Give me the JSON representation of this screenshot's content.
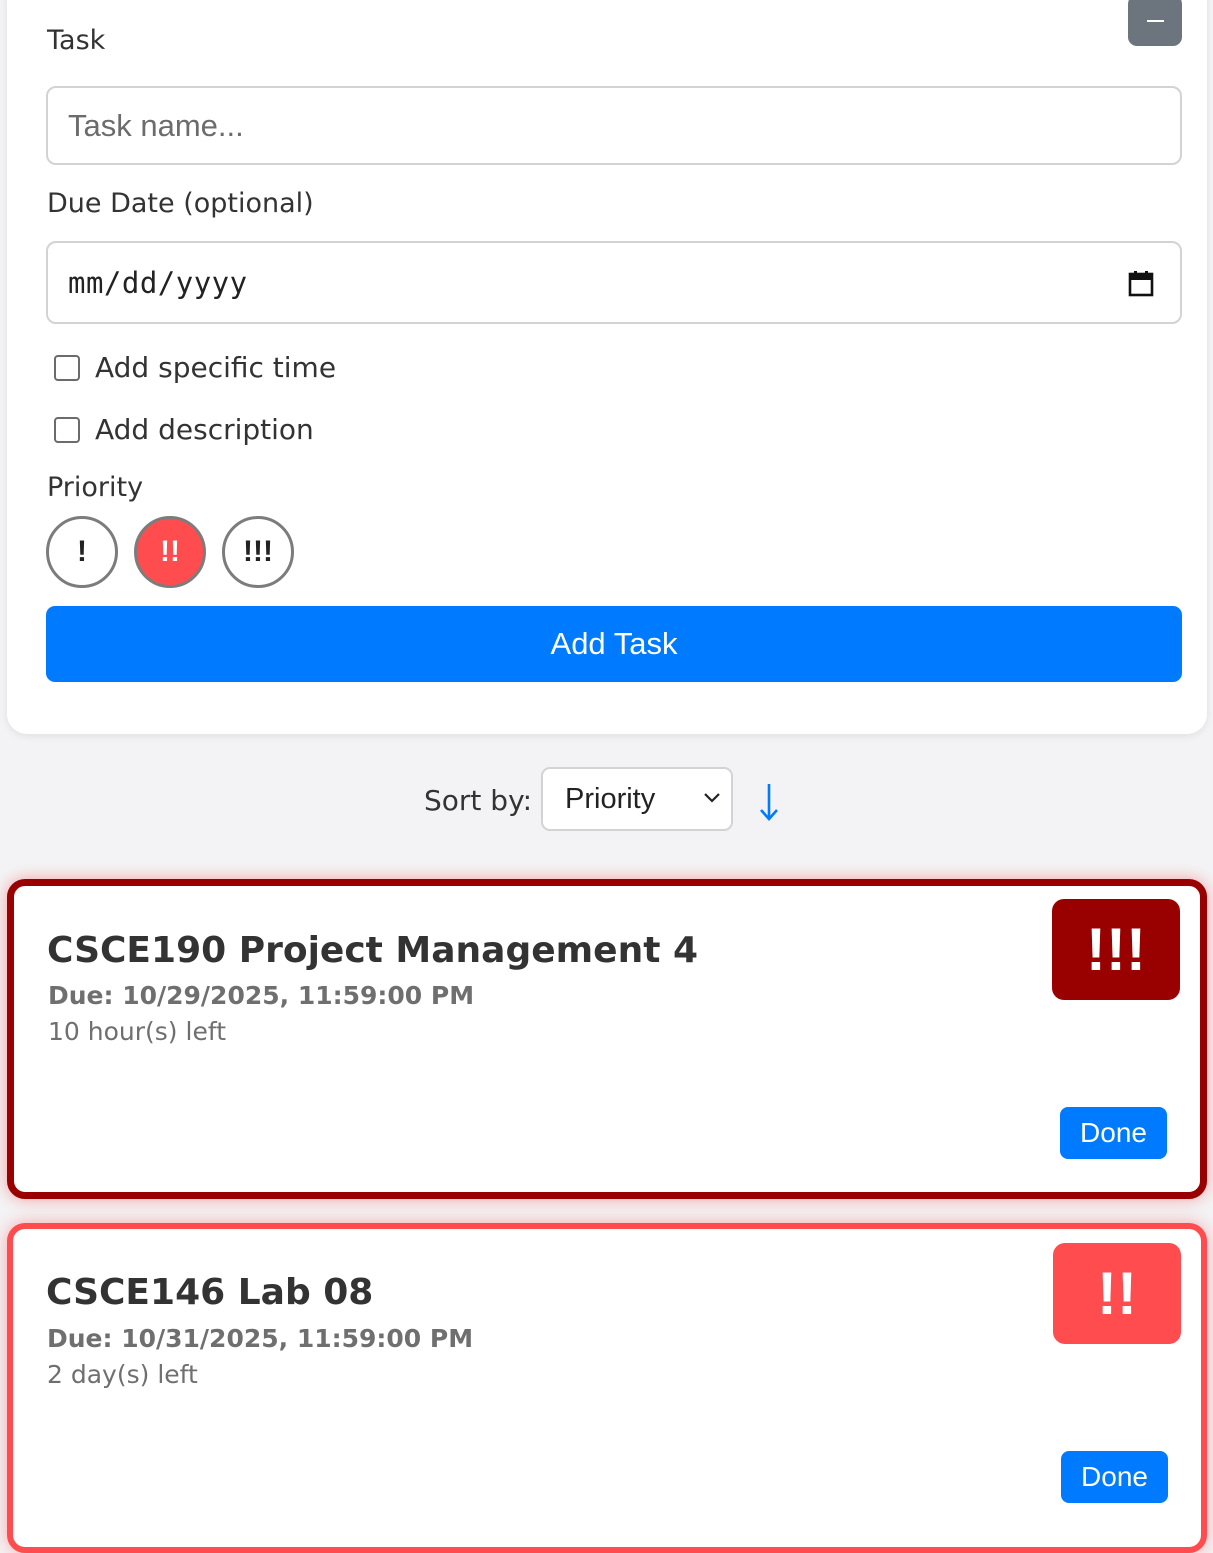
{
  "form": {
    "task_label": "Task",
    "task_placeholder": "Task name...",
    "due_label": "Due Date (optional)",
    "due_value": "mm/dd/yyyy",
    "specific_time_label": "Add specific time",
    "description_label": "Add description",
    "priority_label": "Priority",
    "priority_options": [
      "!",
      "!!",
      "!!!"
    ],
    "selected_priority": "!!",
    "add_button": "Add Task",
    "collapse_icon": "minus-icon",
    "calendar_icon": "calendar-icon"
  },
  "sort": {
    "label": "Sort by:",
    "selected": "Priority",
    "direction_icon": "arrow-down-icon"
  },
  "tasks": [
    {
      "title": "CSCE190 Project Management 4",
      "due": "Due: 10/29/2025, 11:59:00 PM",
      "time_left": "10 hour(s) left",
      "priority": "!!!",
      "priority_color": "#990000",
      "done_label": "Done"
    },
    {
      "title": "CSCE146 Lab 08",
      "due": "Due: 10/31/2025, 11:59:00 PM",
      "time_left": "2 day(s) left",
      "priority": "!!",
      "priority_color": "#ff4d4f",
      "done_label": "Done"
    }
  ],
  "colors": {
    "primary": "#007bff",
    "secondary": "#6c757d",
    "high_priority": "#990000",
    "medium_priority": "#ff4d4f"
  }
}
